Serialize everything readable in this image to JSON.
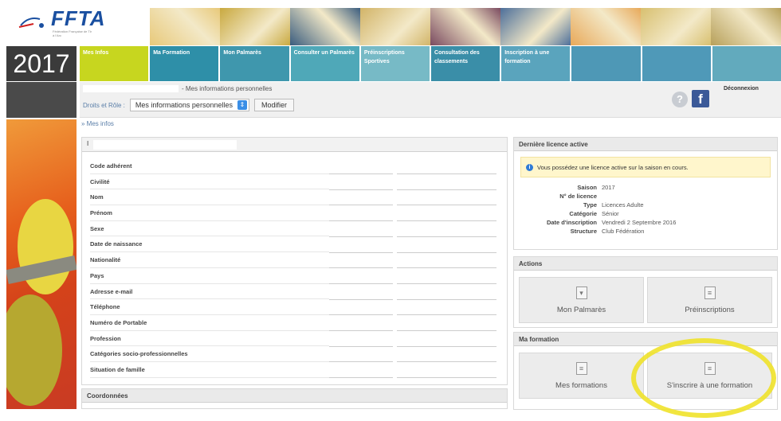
{
  "header": {
    "logo_text": "FFTA",
    "logo_sub": "Fédération Française de Tir à l'Arc",
    "year": "2017",
    "photo_colors": [
      "#e8c97a",
      "#c9a940",
      "#3a5c7e",
      "#d2b468",
      "#7a4a60",
      "#4d6f9a",
      "#e8a95a",
      "#d8c070",
      "#b7a05a"
    ]
  },
  "nav": {
    "items": [
      {
        "label": "Mes Infos",
        "color": "#c7d61f"
      },
      {
        "label": "Ma Formation",
        "color": "#2e8fa8"
      },
      {
        "label": "Mon Palmarès",
        "color": "#3f97ad"
      },
      {
        "label": "Consulter un Palmarès",
        "color": "#4fa8b8"
      },
      {
        "label": "Préinscriptions Sportives",
        "color": "#77bac6"
      },
      {
        "label": "Consultation des classements",
        "color": "#3a8ea8"
      },
      {
        "label": "Inscription à une formation",
        "color": "#5aa4bd"
      },
      {
        "label": "",
        "color": "#4e98b6"
      },
      {
        "label": "",
        "color": "#4f99b8"
      },
      {
        "label": "",
        "color": "#62aabd"
      }
    ]
  },
  "subheader": {
    "user_suffix": "- Mes informations personnelles",
    "role_label": "Droits et Rôle :",
    "role_value": "Mes informations personnelles",
    "modify": "Modifier",
    "help": "?",
    "facebook": "f",
    "logout": "Déconnexion"
  },
  "breadcrumb": "» Mes infos",
  "info": {
    "first": "I",
    "rows": [
      "Code adhérent",
      "Civilité",
      "Nom",
      "Prénom",
      "Sexe",
      "Date de naissance",
      "Nationalité",
      "Pays",
      "Adresse e-mail",
      "Téléphone",
      "Numéro de Portable",
      "Profession",
      "Catégories socio-professionnelles",
      "Situation de famille"
    ]
  },
  "coordinates": "Coordonnées",
  "licence": {
    "title": "Dernière licence active",
    "alert": "Vous possédez une licence active sur la saison en cours.",
    "rows": [
      {
        "k": "Saison",
        "v": "2017"
      },
      {
        "k": "N° de licence",
        "v": ""
      },
      {
        "k": "Type",
        "v": "Licences Adulte"
      },
      {
        "k": "Catégorie",
        "v": "Sénior"
      },
      {
        "k": "Date d'inscription",
        "v": "Vendredi 2 Septembre 2016"
      },
      {
        "k": "Structure",
        "v": "Club Fédération"
      }
    ]
  },
  "actions": {
    "title": "Actions",
    "palmares": "Mon Palmarès",
    "preinscriptions": "Préinscriptions"
  },
  "formation": {
    "title": "Ma formation",
    "mes": "Mes formations",
    "inscrire": "S'inscrire à une formation"
  }
}
